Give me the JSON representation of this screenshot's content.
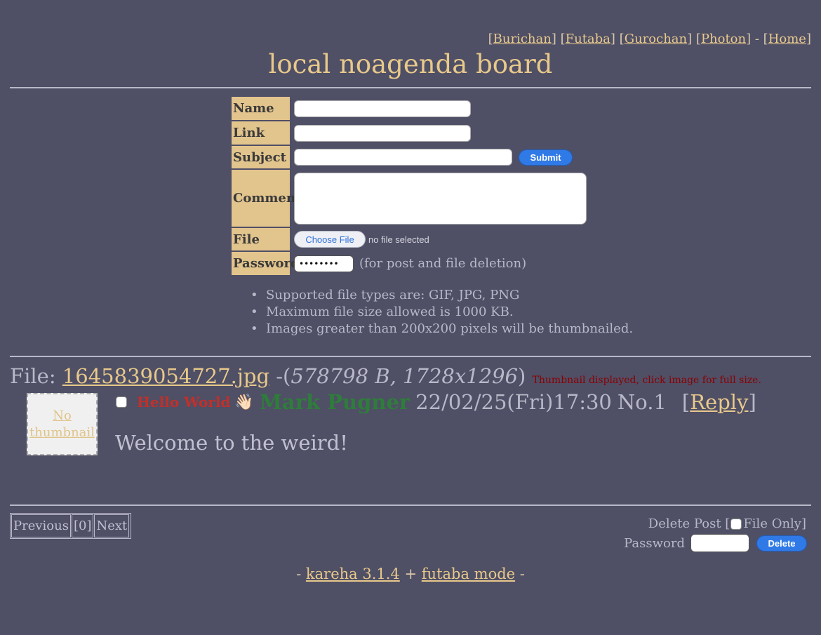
{
  "nav": {
    "links": [
      "Burichan",
      "Futaba",
      "Gurochan",
      "Photon"
    ],
    "home": "Home"
  },
  "board_title": "local noagenda board",
  "form": {
    "name_label": "Name",
    "link_label": "Link",
    "subject_label": "Subject",
    "comment_label": "Comment",
    "file_label": "File",
    "password_label": "Password",
    "submit_label": "Submit",
    "choose_file_label": "Choose File",
    "no_file_text": "no file selected",
    "password_value": "••••••••",
    "password_note": "(for post and file deletion)",
    "rules": [
      "Supported file types are: GIF, JPG, PNG",
      "Maximum file size allowed is 1000 KB.",
      "Images greater than 200x200 pixels will be thumbnailed."
    ]
  },
  "thread": {
    "file_prefix": "File:",
    "file_name": "1645839054727.jpg",
    "file_meta": "578798 B, 1728x1296",
    "thumb_note": "Thumbnail displayed, click image for full size.",
    "thumb_text_1": "No",
    "thumb_text_2": "thumbnail",
    "subject": "Hello World",
    "wave_emoji": "👋🏻",
    "poster": "Mark Pugner",
    "date": "22/02/25(Fri)17:30",
    "post_no": "No.1",
    "reply_label": "Reply",
    "body": "Welcome to the weird!"
  },
  "pager": {
    "previous": "Previous",
    "page": "[0]",
    "next": "Next"
  },
  "delete": {
    "label_prefix": "Delete Post [",
    "file_only": "File Only]",
    "password_label": "Password",
    "button": "Delete"
  },
  "footer": {
    "kareha": "kareha 3.1.4",
    "plus": "+",
    "mode": "futaba mode"
  }
}
